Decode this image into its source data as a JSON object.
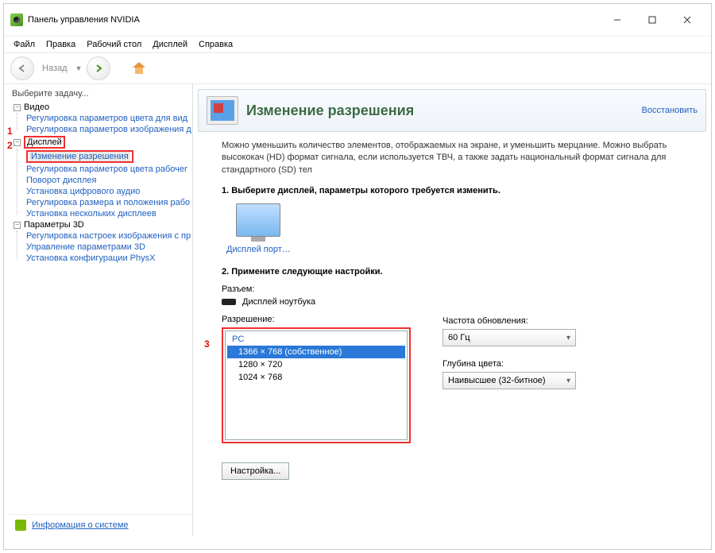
{
  "window": {
    "title": "Панель управления NVIDIA"
  },
  "menu": [
    "Файл",
    "Правка",
    "Рабочий стол",
    "Дисплей",
    "Справка"
  ],
  "toolbar": {
    "back_label": "Назад"
  },
  "sidebar": {
    "select_task": "Выберите задачу...",
    "video": {
      "label": "Видео",
      "items": [
        "Регулировка параметров цвета для вид",
        "Регулировка параметров изображения д"
      ]
    },
    "display": {
      "label": "Дисплей",
      "items": [
        "Изменение разрешения",
        "Регулировка параметров цвета рабочег",
        "Поворот дисплея",
        "Установка цифрового аудио",
        "Регулировка размера и положения рабо",
        "Установка нескольких дисплеев"
      ]
    },
    "params3d": {
      "label": "Параметры 3D",
      "items": [
        "Регулировка настроек изображения с пр",
        "Управление параметрами 3D",
        "Установка конфигурации PhysX"
      ]
    },
    "sysinfo": "Информация о системе"
  },
  "callouts": {
    "c1": "1",
    "c2": "2",
    "c3": "3"
  },
  "content": {
    "header_title": "Изменение разрешения",
    "restore": "Восстановить",
    "description": "Можно уменьшить количество элементов, отображаемых на экране, и уменьшить мерцание. Можно выбрать высококач (HD) формат сигнала, если используется ТВЧ, а также задать национальный формат сигнала для стандартного (SD) тел",
    "step1": {
      "h": "1. Выберите дисплей, параметры которого требуется изменить.",
      "display_name": "Дисплей порт…"
    },
    "step2": {
      "h": "2. Примените следующие настройки.",
      "connector_label": "Разъем:",
      "connector_value": "Дисплей ноутбука",
      "resolution_label": "Разрешение:",
      "res_group": "PC",
      "resolutions": [
        "1366 × 768 (собственное)",
        "1280 × 720",
        "1024 × 768"
      ],
      "refresh_label": "Частота обновления:",
      "refresh_value": "60 Гц",
      "depth_label": "Глубина цвета:",
      "depth_value": "Наивысшее (32-битное)",
      "customize_btn": "Настройка..."
    }
  }
}
